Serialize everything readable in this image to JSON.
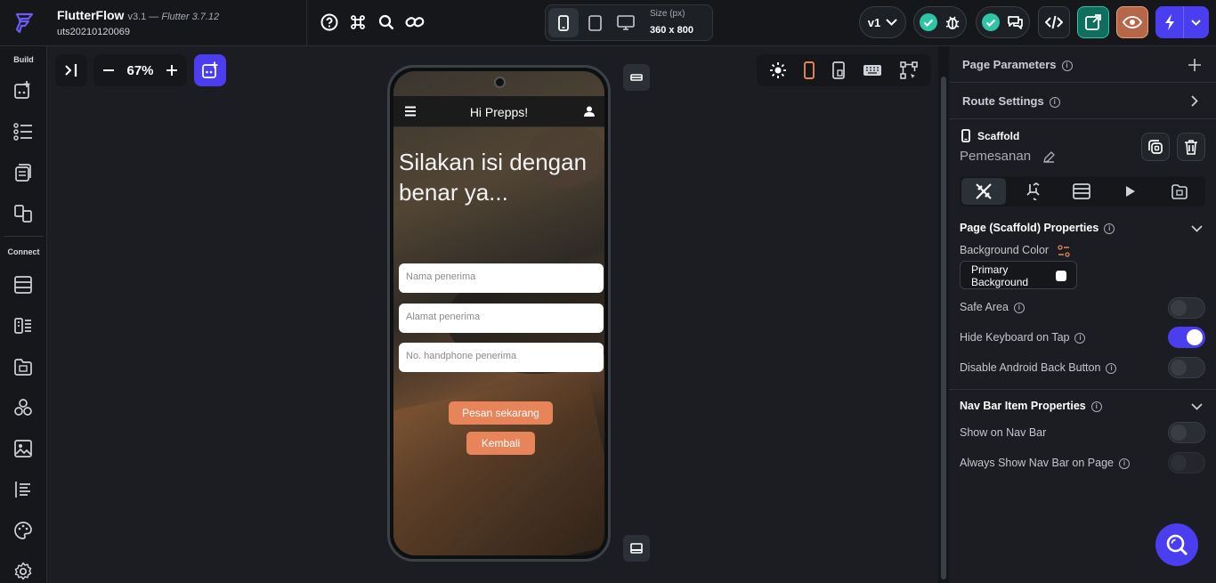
{
  "app": {
    "name": "FlutterFlow",
    "version": "v3.1 —",
    "flutter": "Flutter 3.7.12",
    "project": "uts20210120069"
  },
  "size": {
    "label": "Size (px)",
    "value": "360 x 800"
  },
  "version_select": "v1",
  "leftbar": {
    "build_label": "Build",
    "connect_label": "Connect"
  },
  "canvas": {
    "zoom": "67%"
  },
  "phone": {
    "title": "Hi Prepps!",
    "heading": "Silakan isi dengan benar ya...",
    "fields": [
      "Nama penerima",
      "Alamat penerima",
      "No. handphone penerima"
    ],
    "primary_button": "Pesan sekarang",
    "secondary_button": "Kembali"
  },
  "panel": {
    "page_parameters": "Page Parameters",
    "route_settings": "Route Settings",
    "widget_type": "Scaffold",
    "page_name": "Pemesanan",
    "section_page": "Page (Scaffold) Properties",
    "bg_color_label": "Background Color",
    "bg_color_value": "Primary Background",
    "safe_area": "Safe Area",
    "hide_keyboard": "Hide Keyboard on Tap",
    "disable_back": "Disable Android Back Button",
    "section_nav": "Nav Bar Item Properties",
    "show_nav": "Show on Nav Bar",
    "always_nav": "Always Show Nav Bar on Page",
    "toggles": {
      "safe_area": false,
      "hide_keyboard": true,
      "disable_back": false,
      "show_nav": false,
      "always_nav": false
    }
  },
  "colors": {
    "accent": "#4b3ef0",
    "teal": "#2ec4a6",
    "button": "#e8845a",
    "preview": "#b5674a",
    "share": "#0f6e5e"
  }
}
